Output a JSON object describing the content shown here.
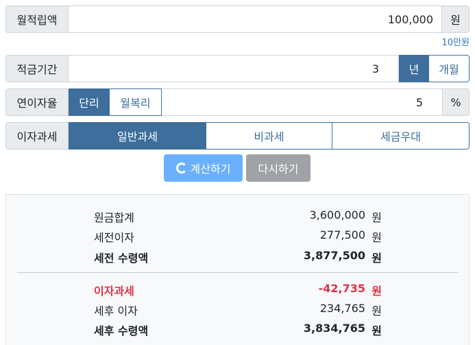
{
  "monthly": {
    "label": "월적립액",
    "value": "100,000",
    "unit": "원",
    "hint": "10만원"
  },
  "period": {
    "label": "적금기간",
    "value": "3",
    "options": [
      "년",
      "개월"
    ]
  },
  "rate": {
    "label": "연이자율",
    "options": [
      "단리",
      "월복리"
    ],
    "value": "5",
    "unit": "%"
  },
  "tax": {
    "label": "이자과세",
    "options": [
      "일반과세",
      "비과세",
      "세금우대"
    ]
  },
  "buttons": {
    "calculate": "계산하기",
    "reset": "다시하기"
  },
  "result": {
    "principal": {
      "label": "원금합계",
      "value": "3,600,000",
      "unit": "원"
    },
    "pretax_interest": {
      "label": "세전이자",
      "value": "277,500",
      "unit": "원"
    },
    "pretax_total": {
      "label": "세전 수령액",
      "value": "3,877,500",
      "unit": "원"
    },
    "tax_amount": {
      "label": "이자과세",
      "value": "-42,735",
      "unit": "원"
    },
    "aftertax_interest": {
      "label": "세후 이자",
      "value": "234,765",
      "unit": "원"
    },
    "aftertax_total": {
      "label": "세후 수령액",
      "value": "3,834,765",
      "unit": "원"
    }
  },
  "colors": {
    "primary": "#3d6e9c",
    "calc_button": "#6ab0ff",
    "reset_button": "#9fa2a6",
    "negative": "#dc3545",
    "hint": "#2a7abf"
  }
}
